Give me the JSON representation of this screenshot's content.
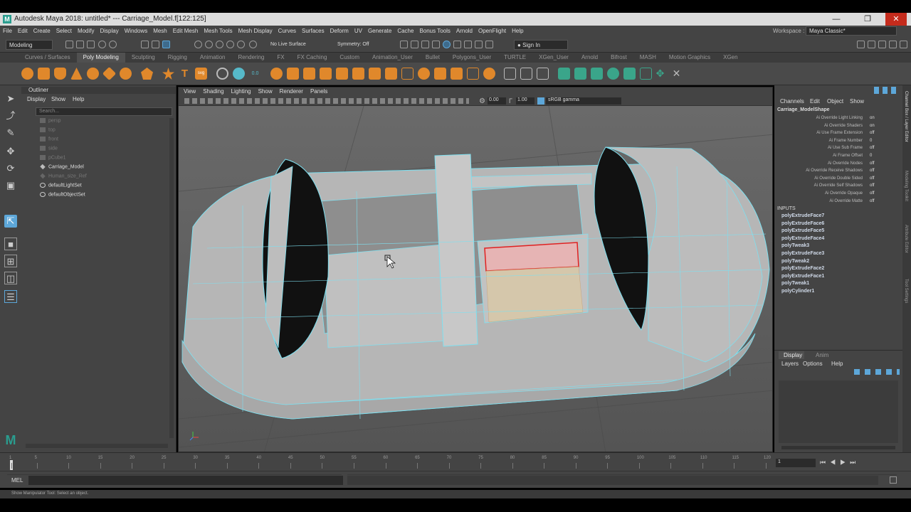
{
  "window": {
    "title": "Autodesk Maya 2018: untitled*   ---   Carriage_Model.f[122:125]"
  },
  "menus": [
    "File",
    "Edit",
    "Create",
    "Select",
    "Modify",
    "Display",
    "Windows",
    "Mesh",
    "Edit Mesh",
    "Mesh Tools",
    "Mesh Display",
    "Curves",
    "Surfaces",
    "Deform",
    "UV",
    "Generate",
    "Cache",
    "Bonus Tools",
    "Arnold",
    "OpenFlight",
    "Help"
  ],
  "workspace": {
    "label": "Workspace :",
    "value": "Maya Classic*"
  },
  "status": {
    "mode": "Modeling",
    "live_surface": "No Live Surface",
    "symmetry": "Symmetry: Off",
    "signin": "Sign In"
  },
  "shelf_tabs": [
    "Curves / Surfaces",
    "Poly Modeling",
    "Sculpting",
    "Rigging",
    "Animation",
    "Rendering",
    "FX",
    "FX Caching",
    "Custom",
    "Animation_User",
    "Bullet",
    "Polygons_User",
    "TURTLE",
    "XGen_User",
    "Arnold",
    "Bifrost",
    "MASH",
    "Motion Graphics",
    "XGen"
  ],
  "active_shelf": "Poly Modeling",
  "outliner": {
    "title": "Outliner",
    "menu": [
      "Display",
      "Show",
      "Help"
    ],
    "search_placeholder": "Search...",
    "items": [
      {
        "label": "persp",
        "dim": true
      },
      {
        "label": "top",
        "dim": true
      },
      {
        "label": "front",
        "dim": true
      },
      {
        "label": "side",
        "dim": true
      },
      {
        "label": "pCube1",
        "dim": true
      },
      {
        "label": "Carriage_Model",
        "dim": false
      },
      {
        "label": "Human_size_Ref",
        "dim": true
      },
      {
        "label": "defaultLightSet",
        "dim": false
      },
      {
        "label": "defaultObjectSet",
        "dim": false
      }
    ]
  },
  "viewport": {
    "menu": [
      "View",
      "Shading",
      "Lighting",
      "Show",
      "Renderer",
      "Panels"
    ],
    "exposure": "0.00",
    "gamma": "1.00",
    "color_space": "sRGB gamma"
  },
  "channel_box": {
    "menu": [
      "Channels",
      "Edit",
      "Object",
      "Show"
    ],
    "node": "Carriage_ModelShape",
    "attrs": [
      {
        "k": "Ai Override Light Linking",
        "v": "on"
      },
      {
        "k": "Ai Override Shaders",
        "v": "on"
      },
      {
        "k": "Ai Use Frame Extension",
        "v": "off"
      },
      {
        "k": "Ai Frame Number",
        "v": "0"
      },
      {
        "k": "Ai Use Sub Frame",
        "v": "off"
      },
      {
        "k": "Ai Frame Offset",
        "v": "0"
      },
      {
        "k": "Ai Override Nodes",
        "v": "off"
      },
      {
        "k": "Ai Override Receive Shadows",
        "v": "off"
      },
      {
        "k": "Ai Override Double Sided",
        "v": "off"
      },
      {
        "k": "Ai Override Self Shadows",
        "v": "off"
      },
      {
        "k": "Ai Override Opaque",
        "v": "off"
      },
      {
        "k": "Ai Override Matte",
        "v": "off"
      }
    ],
    "inputs_label": "INPUTS",
    "inputs": [
      "polyExtrudeFace7",
      "polyExtrudeFace6",
      "polyExtrudeFace5",
      "polyExtrudeFace4",
      "polyTweak3",
      "polyExtrudeFace3",
      "polyTweak2",
      "polyExtrudeFace2",
      "polyExtrudeFace1",
      "polyTweak1",
      "polyCylinder1"
    ]
  },
  "right_tabs": [
    "Channel Box / Layer Editor",
    "Modeling Toolkit",
    "Attribute Editor",
    "Tool Settings"
  ],
  "layer_editor": {
    "tabs": [
      "Display",
      "Anim"
    ],
    "menu": [
      "Layers",
      "Options",
      "Help"
    ]
  },
  "timeline": {
    "ticks": [
      "1",
      "5",
      "10",
      "15",
      "20",
      "25",
      "30",
      "35",
      "40",
      "45",
      "50",
      "55",
      "60",
      "65",
      "70",
      "75",
      "80",
      "85",
      "90",
      "95",
      "100",
      "105",
      "110",
      "115",
      "120"
    ],
    "current_frame": "1"
  },
  "command_line": {
    "label": "MEL"
  },
  "help_line": "Show Manipulator Tool: Select an object.",
  "colors": {
    "accent": "#5da7d9",
    "selection": "#e02020",
    "panel": "#444444",
    "viewport_bg": "#5f5f5f",
    "wire": "#7ee0f0"
  }
}
